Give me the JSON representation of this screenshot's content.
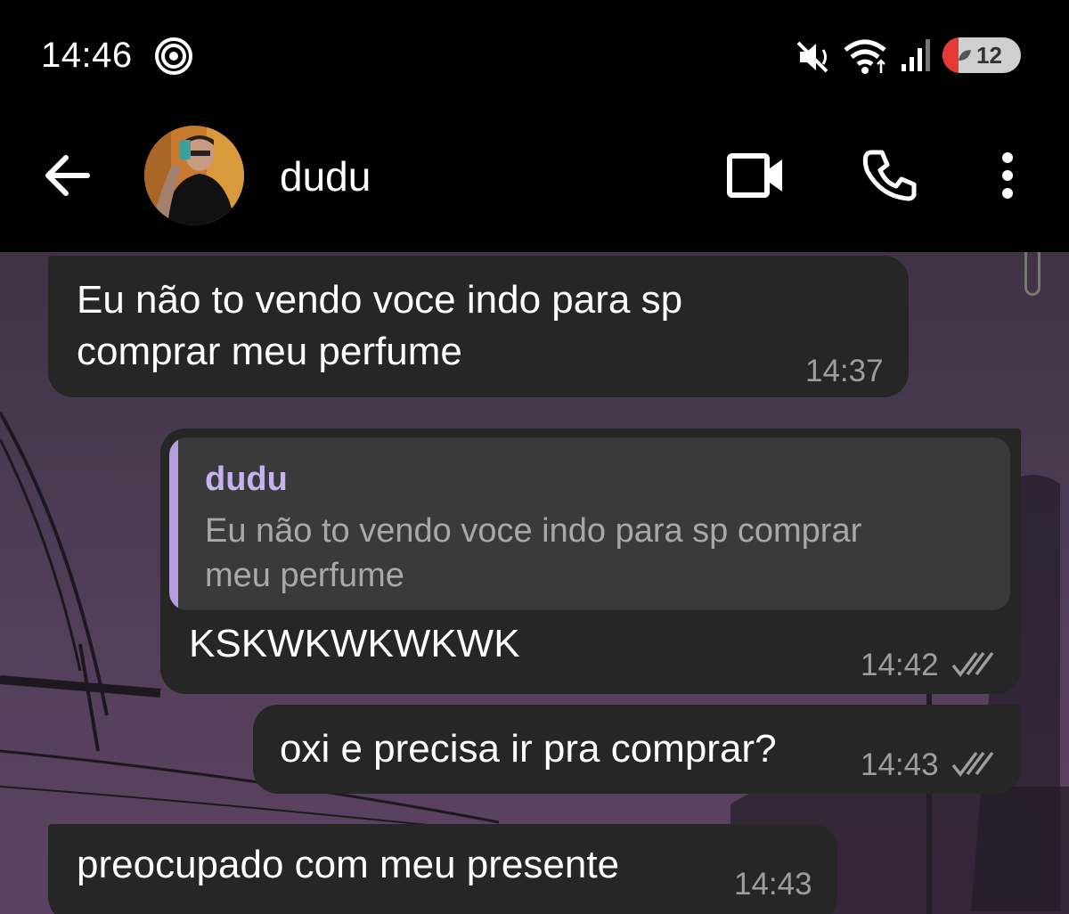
{
  "status_bar": {
    "time": "14:46",
    "battery_level": "12",
    "icons": [
      "radar-icon",
      "mute-icon",
      "wifi-icon",
      "signal-icon",
      "battery-icon"
    ]
  },
  "header": {
    "contact_name": "dudu",
    "icons": [
      "back-arrow-icon",
      "video-call-icon",
      "phone-icon",
      "more-options-icon"
    ]
  },
  "messages": [
    {
      "direction": "incoming",
      "text": "Eu não to vendo voce indo para sp comprar meu perfume",
      "line1": "Eu não to vendo voce indo para sp",
      "line2": "comprar meu perfume",
      "time": "14:37"
    },
    {
      "direction": "outgoing",
      "reply_to_name": "dudu",
      "reply_to_text_line1": "Eu não to vendo voce indo para sp comprar",
      "reply_to_text_line2": "meu perfume",
      "text": "KSKWKWKWKWK",
      "time": "14:42",
      "status": "read"
    },
    {
      "direction": "outgoing",
      "text": "oxi e precisa ir pra comprar?",
      "time": "14:43",
      "status": "read"
    },
    {
      "direction": "incoming",
      "text": "preocupado com meu presente",
      "time": "14:43"
    }
  ],
  "colors": {
    "bubble": "#262626",
    "quote_accent": "#b39ddb",
    "quote_name": "#c5b3f0",
    "timestamp": "#9e9e9e"
  }
}
